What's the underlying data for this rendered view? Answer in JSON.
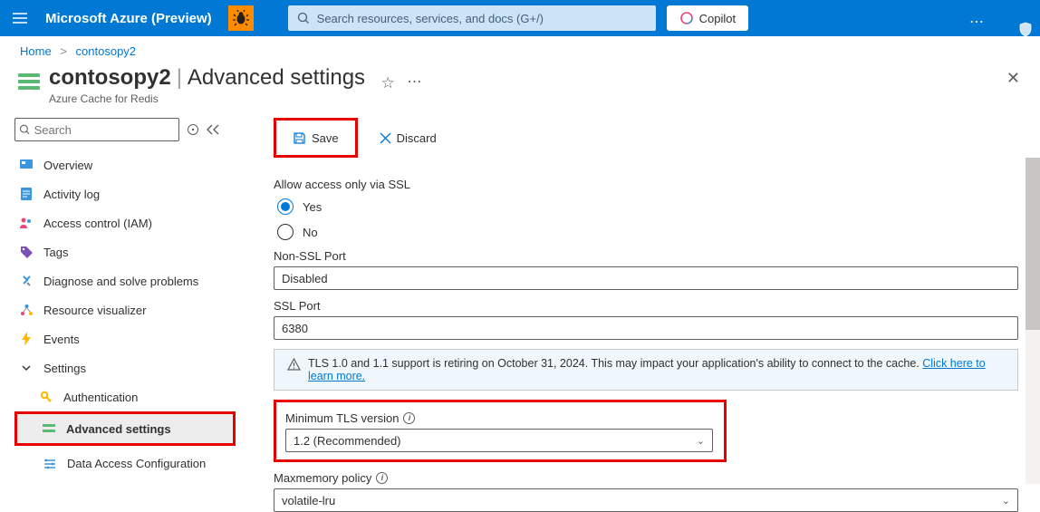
{
  "topbar": {
    "title": "Microsoft Azure (Preview)",
    "search_placeholder": "Search resources, services, and docs (G+/)",
    "copilot_label": "Copilot"
  },
  "breadcrumb": {
    "home_label": "Home",
    "resource_label": "contosopy2"
  },
  "title": {
    "resource": "contosopy2",
    "section": "Advanced settings",
    "subtitle": "Azure Cache for Redis"
  },
  "commands": {
    "save_label": "Save",
    "discard_label": "Discard"
  },
  "side": {
    "search_placeholder": "Search",
    "items": [
      {
        "label": "Overview"
      },
      {
        "label": "Activity log"
      },
      {
        "label": "Access control (IAM)"
      },
      {
        "label": "Tags"
      },
      {
        "label": "Diagnose and solve problems"
      },
      {
        "label": "Resource visualizer"
      },
      {
        "label": "Events"
      },
      {
        "label": "Settings"
      },
      {
        "label": "Authentication"
      },
      {
        "label": "Advanced settings"
      },
      {
        "label": "Data Access Configuration"
      }
    ]
  },
  "form": {
    "ssl_label": "Allow access only via SSL",
    "yes_label": "Yes",
    "no_label": "No",
    "non_ssl_port_label": "Non-SSL Port",
    "non_ssl_port_value": "Disabled",
    "ssl_port_label": "SSL Port",
    "ssl_port_value": "6380",
    "banner_text": "TLS 1.0 and 1.1 support is retiring on October 31, 2024. This may impact your application's ability to connect to the cache. ",
    "banner_link": "Click here to learn more.",
    "min_tls_label": "Minimum TLS version",
    "min_tls_value": "1.2 (Recommended)",
    "maxmemory_label": "Maxmemory policy",
    "maxmemory_value": "volatile-lru"
  }
}
